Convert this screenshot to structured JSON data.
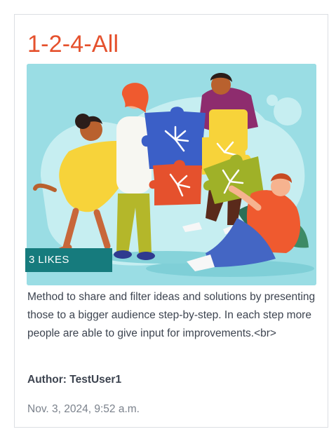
{
  "card": {
    "title": "1-2-4-All",
    "likes_label": "3 LIKES",
    "description": "Method to share and filter ideas and solutions by presenting those to a bigger audience step-by-step. In each step more people are able to give input for improvements.<br>",
    "author": "Author: TestUser1",
    "timestamp": "Nov. 3, 2024, 9:52 a.m."
  },
  "colors": {
    "title": "#e5512d",
    "badge_bg": "#167b7d",
    "hero_bg": "#9adde4",
    "body_text": "#3d4450",
    "muted_text": "#7b828c"
  }
}
